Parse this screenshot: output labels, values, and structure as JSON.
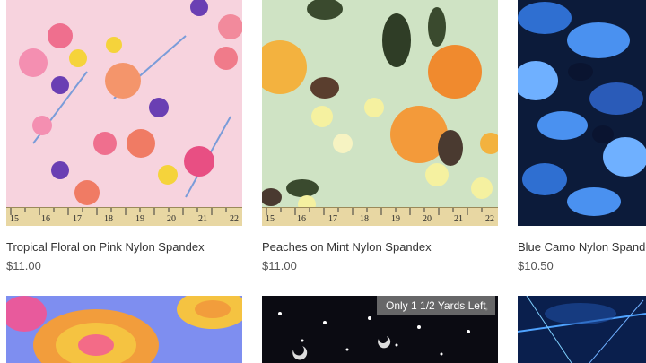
{
  "products": [
    {
      "title": "Tropical Floral on Pink Nylon Spandex",
      "price": "$11.00"
    },
    {
      "title": "Peaches on Mint Nylon Spandex",
      "price": "$11.00"
    },
    {
      "title": "Blue Camo Nylon Spandex",
      "price": "$10.50"
    },
    {
      "title": "",
      "price": ""
    },
    {
      "title": "",
      "price": "",
      "badge": "Only 1 1/2 Yards Left"
    },
    {
      "title": "",
      "price": ""
    }
  ],
  "ruler_numbers": [
    "15",
    "16",
    "17",
    "18",
    "19",
    "20",
    "21",
    "22"
  ],
  "colors": {
    "pink_bg": "#f7d3de",
    "mint_bg": "#cfe3c4",
    "camo_dark": "#0c1b3a",
    "camo_light": "#6fb0ff",
    "ruler": "#e8d7a3"
  }
}
